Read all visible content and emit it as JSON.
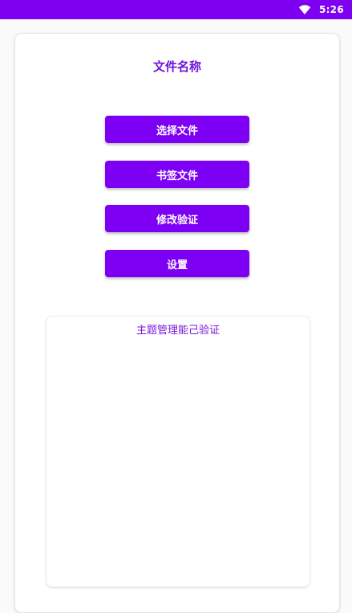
{
  "status_bar": {
    "time": "5:26",
    "background_color": "#7d00f0",
    "icons": [
      "wifi-icon"
    ]
  },
  "main": {
    "title": "文件名称",
    "buttons": [
      {
        "label": "选择文件"
      },
      {
        "label": "书签文件"
      },
      {
        "label": "修改验证"
      },
      {
        "label": "设置"
      }
    ],
    "panel": {
      "title": "主题管理能己验证"
    }
  },
  "colors": {
    "accent": "#7d00f5",
    "title": "#6f12d8"
  }
}
